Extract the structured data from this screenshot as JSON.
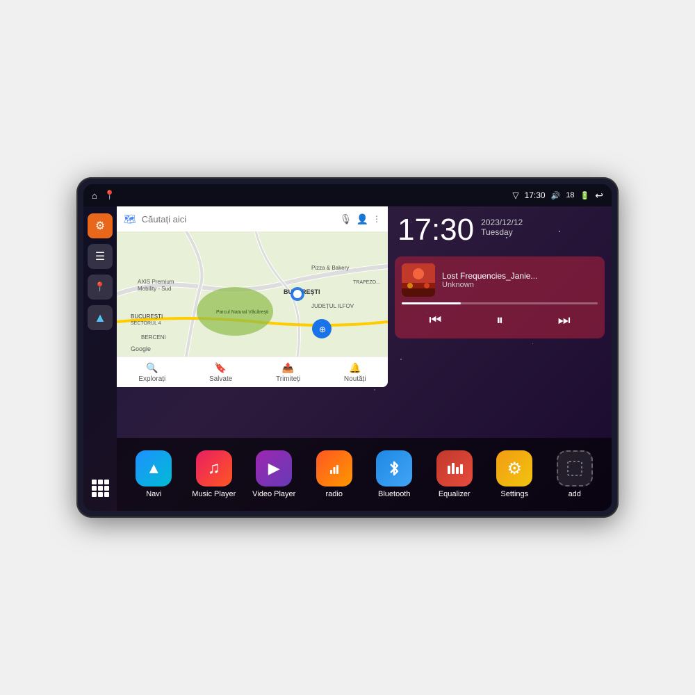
{
  "device": {
    "status_bar": {
      "left_icons": [
        "home",
        "map"
      ],
      "wifi_icon": "wifi",
      "time": "17:30",
      "volume_icon": "volume",
      "battery_level": "18",
      "battery_icon": "battery",
      "back_icon": "back"
    },
    "sidebar": {
      "buttons": [
        {
          "id": "settings",
          "icon": "⚙",
          "style": "orange"
        },
        {
          "id": "files",
          "icon": "☰",
          "style": "dark"
        },
        {
          "id": "map",
          "icon": "📍",
          "style": "dark"
        },
        {
          "id": "navigation",
          "icon": "▲",
          "style": "dark"
        }
      ]
    },
    "map": {
      "search_placeholder": "Căutați aici",
      "bottom_tabs": [
        {
          "label": "Explorați",
          "icon": "🔍"
        },
        {
          "label": "Salvate",
          "icon": "🔖"
        },
        {
          "label": "Trimiteți",
          "icon": "📤"
        },
        {
          "label": "Noutăți",
          "icon": "🔔"
        }
      ]
    },
    "clock": {
      "time": "17:30",
      "date": "2023/12/12",
      "day": "Tuesday"
    },
    "music": {
      "title": "Lost Frequencies_Janie...",
      "artist": "Unknown",
      "progress_percent": 30
    },
    "apps": [
      {
        "id": "navi",
        "label": "Navi",
        "icon": "▲",
        "style": "navi"
      },
      {
        "id": "music-player",
        "label": "Music Player",
        "icon": "♪",
        "style": "music"
      },
      {
        "id": "video-player",
        "label": "Video Player",
        "icon": "▶",
        "style": "video"
      },
      {
        "id": "radio",
        "label": "radio",
        "icon": "📻",
        "style": "radio"
      },
      {
        "id": "bluetooth",
        "label": "Bluetooth",
        "icon": "₿",
        "style": "bluetooth"
      },
      {
        "id": "equalizer",
        "label": "Equalizer",
        "icon": "▮▮▮",
        "style": "equalizer"
      },
      {
        "id": "settings",
        "label": "Settings",
        "icon": "⚙",
        "style": "settings"
      },
      {
        "id": "add",
        "label": "add",
        "icon": "+",
        "style": "add"
      }
    ]
  }
}
